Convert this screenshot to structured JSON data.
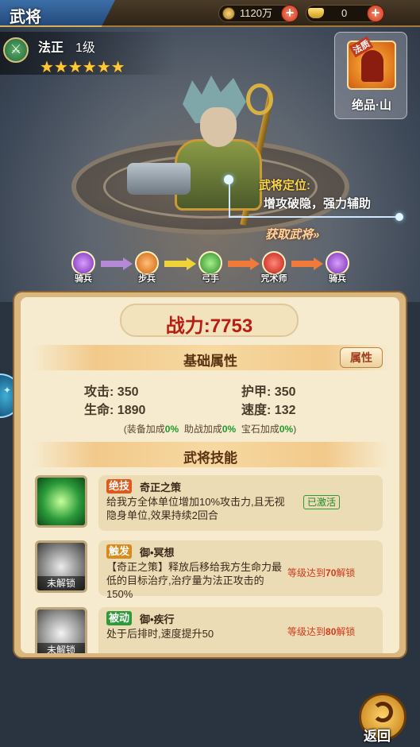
{
  "header": {
    "title": "武将",
    "coins": "1120万",
    "ingots": "0"
  },
  "hero": {
    "name": "法正",
    "level": "1级",
    "stars": "★★★★★★",
    "quality_tag": "法质",
    "quality_label": "绝品·山",
    "position_title": "武将定位:",
    "position_desc": "增攻破隐，强力辅助",
    "obtain_label": "获取武将»"
  },
  "evolution": [
    {
      "label": "骑兵",
      "color": "#9a4ad0"
    },
    {
      "label": "步兵",
      "color": "#e07a1a"
    },
    {
      "label": "弓手",
      "color": "#3aa03a"
    },
    {
      "label": "咒术师",
      "color": "#d8261a"
    },
    {
      "label": "骑兵",
      "color": "#9a4ad0"
    }
  ],
  "panel": {
    "power": "战力:7753",
    "base_section": "基础属性",
    "attr_button": "属性",
    "stats": {
      "attack_label": "攻击:",
      "attack_value": "350",
      "armor_label": "护甲:",
      "armor_value": "350",
      "hp_label": "生命:",
      "hp_value": "1890",
      "speed_label": "速度:",
      "speed_value": "132"
    },
    "bonus": {
      "equip_label": "(装备加成",
      "equip_value": "0%",
      "assist_label": "助战加成",
      "assist_value": "0%",
      "gem_label": "宝石加成",
      "gem_value": "0%",
      "close": ")"
    },
    "skills_section": "武将技能",
    "skills": [
      {
        "tag": "绝技",
        "tag_color": "#e0581a",
        "name": "奇正之策",
        "desc": "给我方全体单位增加10%攻击力,且无视隐身单位,效果持续2回合",
        "status": "已激活"
      },
      {
        "tag": "触发",
        "tag_color": "#d88a1a",
        "name": "御•冥想",
        "desc": "【奇正之策】释放后移给我方生命力最低的目标治疗,治疗量为法正攻击的150%",
        "lock": "未解锁",
        "req_prefix": "等级达到",
        "req_level": "70",
        "req_suffix": "解锁"
      },
      {
        "tag": "被动",
        "tag_color": "#2e9a3a",
        "name": "御•疾行",
        "desc": "处于后排时,速度提升50",
        "lock": "未解锁",
        "req_prefix": "等级达到",
        "req_level": "80",
        "req_suffix": "解锁"
      }
    ]
  },
  "footer": {
    "back_label": "返回"
  }
}
